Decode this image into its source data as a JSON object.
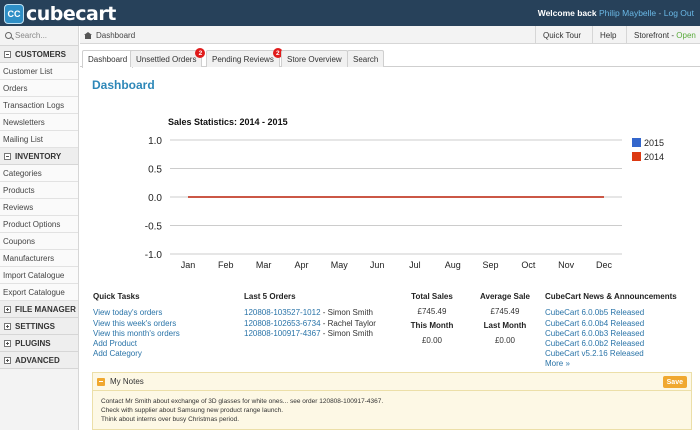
{
  "header": {
    "logo_mark": "CC",
    "logo_text": "cubecart",
    "welcome": "Welcome back",
    "user": "Philip Maybelle",
    "separator": "-",
    "logout": "Log Out"
  },
  "sidebar": {
    "search_placeholder": "Search...",
    "sections": [
      {
        "title": "CUSTOMERS",
        "items": [
          "Customer List",
          "Orders",
          "Transaction Logs",
          "Newsletters",
          "Mailing List"
        ]
      },
      {
        "title": "INVENTORY",
        "items": [
          "Categories",
          "Products",
          "Reviews",
          "Product Options",
          "Coupons",
          "Manufacturers",
          "Import Catalogue",
          "Export Catalogue"
        ]
      },
      {
        "title": "FILE MANAGER"
      },
      {
        "title": "SETTINGS"
      },
      {
        "title": "PLUGINS"
      },
      {
        "title": "ADVANCED"
      }
    ]
  },
  "breadcrumb": "Dashboard",
  "quickbar": {
    "quick_tour": "Quick Tour",
    "help": "Help",
    "storefront": "Storefront",
    "storefront_dash": "-",
    "storefront_status": "Open"
  },
  "tabs": [
    {
      "label": "Dashboard",
      "badge": ""
    },
    {
      "label": "Unsettled Orders",
      "badge": "2"
    },
    {
      "label": "Pending Reviews",
      "badge": "2"
    },
    {
      "label": "Store Overview",
      "badge": ""
    },
    {
      "label": "Search",
      "badge": ""
    }
  ],
  "page_title": "Dashboard",
  "chart_data": {
    "type": "line",
    "title": "Sales Statistics: 2014 - 2015",
    "categories": [
      "Jan",
      "Feb",
      "Mar",
      "Apr",
      "May",
      "Jun",
      "Jul",
      "Aug",
      "Sep",
      "Oct",
      "Nov",
      "Dec"
    ],
    "series": [
      {
        "name": "2015",
        "color": "#3366cc",
        "values": [
          0,
          0,
          0,
          0,
          0,
          0,
          0,
          0,
          0,
          0,
          0,
          0
        ]
      },
      {
        "name": "2014",
        "color": "#dc3912",
        "values": [
          0,
          0,
          0,
          0,
          0,
          0,
          0,
          0,
          0,
          0,
          0,
          0
        ]
      }
    ],
    "yticks": [
      "1.0",
      "0.5",
      "0.0",
      "-0.5",
      "-1.0"
    ],
    "ylim": [
      -1,
      1
    ],
    "legend": "right",
    "grid": true
  },
  "quick_tasks": {
    "title": "Quick Tasks",
    "links": [
      "View today's orders",
      "View this week's orders",
      "View this month's orders",
      "Add Product",
      "Add Category"
    ]
  },
  "last_orders": {
    "title": "Last 5 Orders",
    "rows": [
      {
        "id": "120808-103527-1012",
        "name": "- Simon Smith"
      },
      {
        "id": "120808-102653-6734",
        "name": "- Rachel Taylor"
      },
      {
        "id": "120808-100917-4367",
        "name": "- Simon Smith"
      }
    ]
  },
  "stats": {
    "total_sales_label": "Total Sales",
    "total_sales": "£745.49",
    "this_month_label": "This Month",
    "this_month": "£0.00",
    "average_sale_label": "Average Sale",
    "average_sale": "£745.49",
    "last_month_label": "Last Month",
    "last_month": "£0.00"
  },
  "news": {
    "title": "CubeCart News & Announcements",
    "items": [
      "CubeCart 6.0.0b5 Released",
      "CubeCart 6.0.0b4 Released",
      "CubeCart 6.0.0b3 Released",
      "CubeCart 6.0.0b2 Released",
      "CubeCart v5.2.16 Released"
    ],
    "more": "More »"
  },
  "notes": {
    "title": "My Notes",
    "save": "Save",
    "lines": [
      "Contact Mr Smith about exchange of 3D glasses for white ones... see order 120808-100917-4367.",
      "Check with supplier about Samsung new product range launch.",
      "Think about interns over busy Christmas period."
    ]
  }
}
